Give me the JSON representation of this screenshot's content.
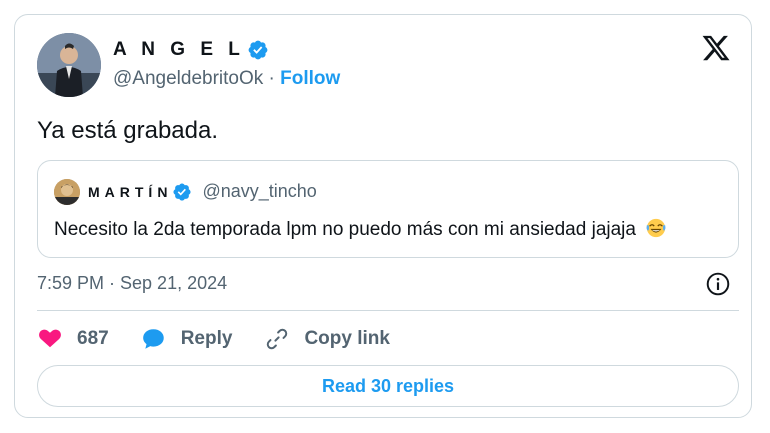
{
  "author": {
    "name": "A N G E L",
    "handle": "@AngeldebritoOk",
    "separator": " · ",
    "follow_label": "Follow"
  },
  "tweet": {
    "text": "Ya está grabada.",
    "timestamp": "7:59 PM · Sep 21, 2024"
  },
  "quote": {
    "name": "MARTÍN",
    "handle": "@navy_tincho",
    "text": "Necesito la 2da temporada lpm no puedo más con mi ansiedad jajaja"
  },
  "actions": {
    "likes": "687",
    "reply_label": "Reply",
    "copy_label": "Copy link"
  },
  "read_replies_label": "Read 30 replies",
  "colors": {
    "accent": "#1d9bf0",
    "like": "#f91880",
    "muted": "#536471",
    "border": "#cfd9de"
  },
  "icons": [
    "verified-badge-icon",
    "x-logo-icon",
    "info-icon",
    "heart-icon",
    "reply-bubble-icon",
    "link-icon",
    "laughing-tears-emoji-icon"
  ]
}
